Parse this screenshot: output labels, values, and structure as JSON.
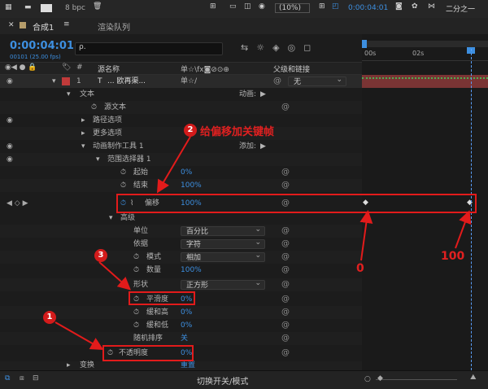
{
  "topbar": {
    "bpc": "8 bpc",
    "zoom": "(10%)",
    "timecode": "0:00:04:01",
    "workspace": "二分之一"
  },
  "tabs": {
    "comp": "合成1",
    "render_queue": "渲染队列"
  },
  "time": {
    "current": "0:00:04:01",
    "sub": "00101 (25.00 fps)",
    "search_placeholder": "ρ."
  },
  "ruler": {
    "t0": "00s",
    "t2": "02s"
  },
  "header": {
    "hash": "#",
    "source_name": "源名称",
    "switches": "单☆\\fx◙⊘⊙⊕",
    "parent": "父级和链接"
  },
  "layer": {
    "index": "1",
    "type": "T",
    "name": "... 欧再渠...",
    "parent": "无"
  },
  "rows": {
    "text": "文本",
    "animation": "动画:",
    "source_text": "源文本",
    "path_options": "路径选项",
    "more_options": "更多选项",
    "animator": "动画制作工具 1",
    "add": "添加:",
    "range_selector": "范围选择器 1",
    "start": "起始",
    "start_val": "0%",
    "end": "结束",
    "end_val": "100%",
    "offset": "偏移",
    "offset_val": "100%",
    "advanced": "高级",
    "unit": "单位",
    "unit_val": "百分比",
    "based_on": "依据",
    "based_on_val": "字符",
    "mode": "模式",
    "mode_val": "相加",
    "amount": "数量",
    "amount_val": "100%",
    "shape": "形状",
    "shape_val": "正方形",
    "smoothness": "平滑度",
    "smoothness_val": "0%",
    "ease_high": "缓和高",
    "ease_high_val": "0%",
    "ease_low": "缓和低",
    "ease_low_val": "0%",
    "random_order": "随机排序",
    "random_val": "关",
    "opacity": "不透明度",
    "opacity_val": "0%",
    "transform": "变换",
    "reset": "重置"
  },
  "bottom": {
    "toggle": "切换开关/模式"
  },
  "annotations": {
    "n1": "1",
    "n2": "2",
    "n3": "3",
    "note2": "给偏移加关键帧",
    "kf0": "0",
    "kf100": "100"
  },
  "colors": {
    "accent": "#3d8fe0",
    "annotation": "#e21b1b",
    "layer_label": "#c03a3a"
  }
}
